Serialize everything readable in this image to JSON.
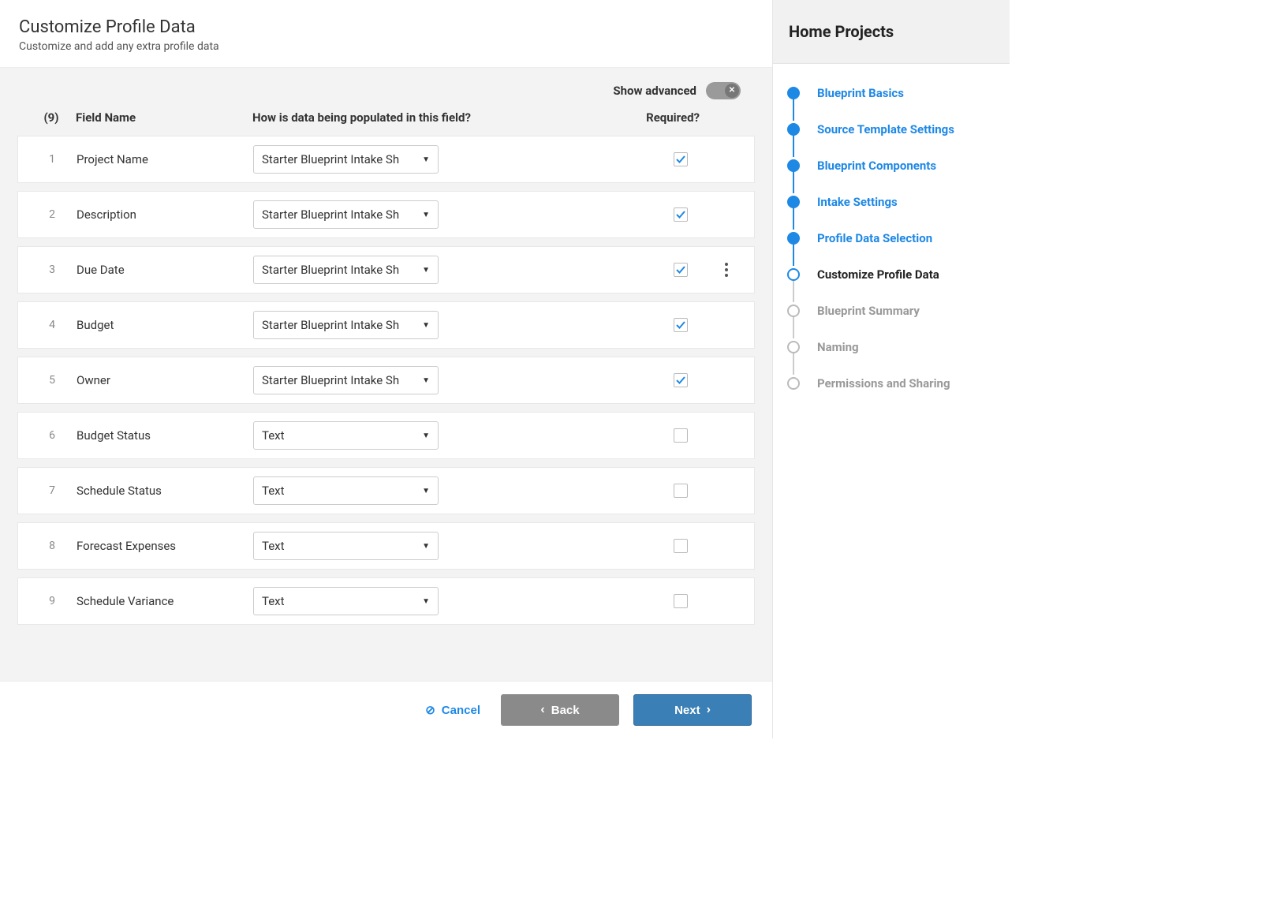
{
  "header": {
    "title": "Customize Profile Data",
    "subtitle": "Customize and add any extra profile data"
  },
  "toolbar": {
    "show_advanced_label": "Show advanced",
    "show_advanced_on": false
  },
  "columns": {
    "count_label": "(9)",
    "name": "Field Name",
    "populated": "How is data being populated in this field?",
    "required": "Required?"
  },
  "fields": [
    {
      "num": "1",
      "name": "Project Name",
      "source": "Starter Blueprint Intake Sh",
      "required": true,
      "show_menu": false
    },
    {
      "num": "2",
      "name": "Description",
      "source": "Starter Blueprint Intake Sh",
      "required": true,
      "show_menu": false
    },
    {
      "num": "3",
      "name": "Due Date",
      "source": "Starter Blueprint Intake Sh",
      "required": true,
      "show_menu": true
    },
    {
      "num": "4",
      "name": "Budget",
      "source": "Starter Blueprint Intake Sh",
      "required": true,
      "show_menu": false
    },
    {
      "num": "5",
      "name": "Owner",
      "source": "Starter Blueprint Intake Sh",
      "required": true,
      "show_menu": false
    },
    {
      "num": "6",
      "name": "Budget Status",
      "source": "Text",
      "required": false,
      "show_menu": false
    },
    {
      "num": "7",
      "name": "Schedule Status",
      "source": "Text",
      "required": false,
      "show_menu": false
    },
    {
      "num": "8",
      "name": "Forecast Expenses",
      "source": "Text",
      "required": false,
      "show_menu": false
    },
    {
      "num": "9",
      "name": "Schedule Variance",
      "source": "Text",
      "required": false,
      "show_menu": false
    }
  ],
  "footer": {
    "cancel": "Cancel",
    "back": "Back",
    "next": "Next"
  },
  "sidebar": {
    "title": "Home Projects",
    "steps": [
      {
        "label": "Blueprint Basics",
        "state": "done"
      },
      {
        "label": "Source Template Settings",
        "state": "done"
      },
      {
        "label": "Blueprint Components",
        "state": "done"
      },
      {
        "label": "Intake Settings",
        "state": "done"
      },
      {
        "label": "Profile Data Selection",
        "state": "done"
      },
      {
        "label": "Customize Profile Data",
        "state": "current"
      },
      {
        "label": "Blueprint Summary",
        "state": "future"
      },
      {
        "label": "Naming",
        "state": "future"
      },
      {
        "label": "Permissions and Sharing",
        "state": "future"
      }
    ]
  }
}
